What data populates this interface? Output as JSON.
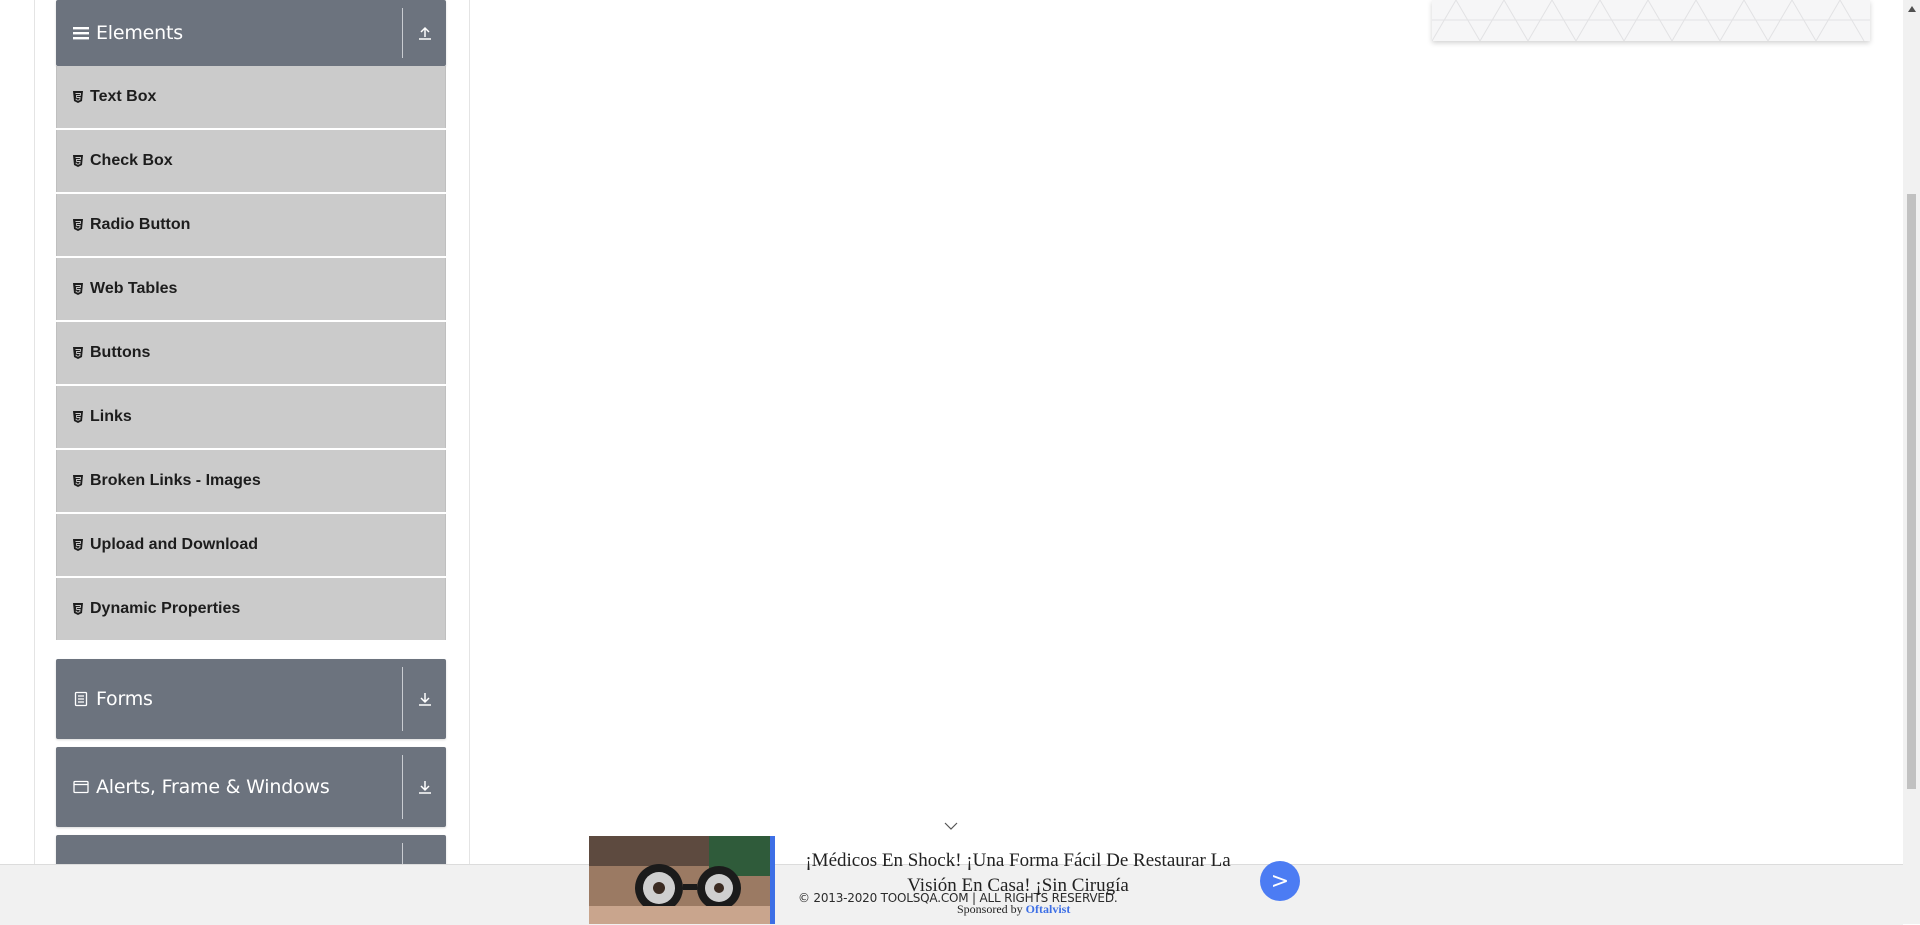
{
  "sidebar": {
    "elements_group": {
      "title": "Elements",
      "toggle_icon": "arrow-up-tray-icon"
    },
    "items": [
      {
        "label": "Text Box",
        "icon": "html5-shield-icon"
      },
      {
        "label": "Check Box",
        "icon": "html5-shield-icon"
      },
      {
        "label": "Radio Button",
        "icon": "html5-shield-icon"
      },
      {
        "label": "Web Tables",
        "icon": "html5-shield-icon"
      },
      {
        "label": "Buttons",
        "icon": "html5-shield-icon"
      },
      {
        "label": "Links",
        "icon": "html5-shield-icon"
      },
      {
        "label": "Broken Links - Images",
        "icon": "html5-shield-icon"
      },
      {
        "label": "Upload and Download",
        "icon": "html5-shield-icon"
      },
      {
        "label": "Dynamic Properties",
        "icon": "html5-shield-icon"
      }
    ],
    "forms_group": {
      "title": "Forms",
      "toggle_icon": "arrow-down-tray-icon"
    },
    "alerts_group": {
      "title": "Alerts, Frame & Windows",
      "toggle_icon": "arrow-down-tray-icon"
    }
  },
  "footer": {
    "copyright": "© 2013-2020 TOOLSQA.COM | ALL RIGHTS RESERVED."
  },
  "ad": {
    "headline": "¡Médicos En Shock! ¡Una Forma Fácil De Restaurar La Visión En Casa! ¡Sin Cirugía",
    "sponsored_prefix": "Sponsored by",
    "sponsor": "Oftalvist",
    "go_label": ">"
  },
  "colors": {
    "group_header": "#6c737e",
    "menu_item": "#cbcbcb",
    "ad_accent": "#4c7cf3"
  }
}
